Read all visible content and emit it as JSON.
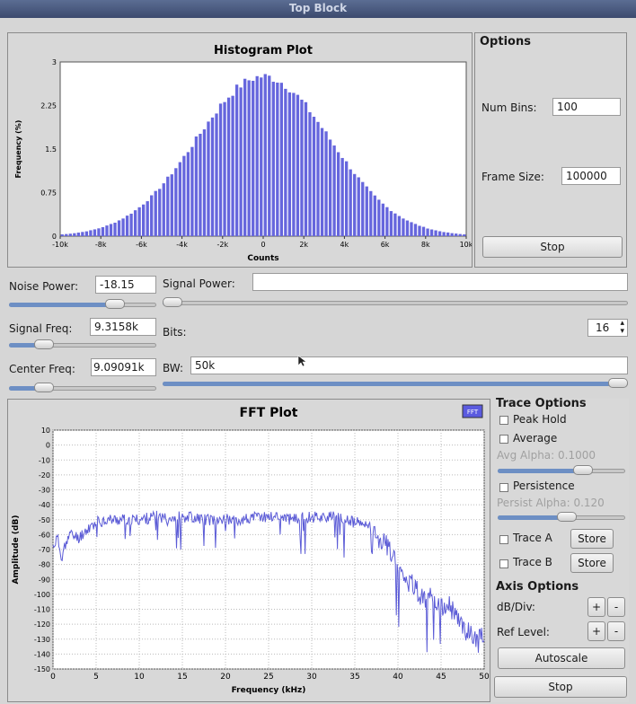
{
  "window": {
    "title": "Top Block"
  },
  "histogram": {
    "title": "Histogram Plot",
    "options_title": "Options",
    "num_bins_label": "Num Bins:",
    "num_bins_value": "100",
    "frame_size_label": "Frame Size:",
    "frame_size_value": "100000",
    "stop_label": "Stop"
  },
  "controls": {
    "noise_power_label": "Noise Power:",
    "noise_power_value": "-18.15",
    "signal_power_label": "Signal Power:",
    "signal_power_value": "",
    "signal_freq_label": "Signal Freq:",
    "signal_freq_value": "9.3158k",
    "bits_label": "Bits:",
    "bits_value": "16",
    "center_freq_label": "Center Freq:",
    "center_freq_value": "9.09091k",
    "bw_label": "BW:",
    "bw_value": "50k",
    "noise_power_level": 0.75,
    "signal_power_level": 0.0,
    "signal_freq_level": 0.2,
    "center_freq_level": 0.2,
    "bw_level": 1.0
  },
  "fft": {
    "title": "FFT Plot",
    "badge": "FFT",
    "trace_options_title": "Trace Options",
    "peak_hold_label": "Peak Hold",
    "average_label": "Average",
    "avg_alpha_label": "Avg Alpha: 0.1000",
    "avg_alpha_level": 0.7,
    "persistence_label": "Persistence",
    "persist_alpha_label": "Persist Alpha: 0.120",
    "persist_alpha_level": 0.55,
    "trace_a_label": "Trace A",
    "trace_b_label": "Trace B",
    "store_label": "Store",
    "axis_options_title": "Axis Options",
    "db_div_label": "dB/Div:",
    "ref_level_label": "Ref Level:",
    "plus_label": "+",
    "minus_label": "-",
    "autoscale_label": "Autoscale",
    "stop_label": "Stop"
  },
  "colors": {
    "trace": "#5b5bd6",
    "bar": "#6666dd",
    "slider_fill": "#6d8fc4"
  },
  "chart_data": [
    {
      "type": "bar",
      "title": "Histogram Plot",
      "xlabel": "Counts",
      "ylabel": "Frequency (%)",
      "xlim": [
        -10000,
        10000
      ],
      "ylim": [
        0,
        3
      ],
      "xticks": [
        "-10k",
        "-8k",
        "-6k",
        "-4k",
        "-2k",
        "0",
        "2k",
        "4k",
        "6k",
        "8k",
        "10k"
      ],
      "yticks": [
        "0",
        "0.75",
        "1.5",
        "2.25",
        "3"
      ],
      "distribution": "gaussian",
      "mean": 0,
      "std": 3300,
      "peak": 2.75,
      "bins": 100
    },
    {
      "type": "line",
      "title": "FFT Plot",
      "xlabel": "Frequency (kHz)",
      "ylabel": "Amplitude (dB)",
      "xlim": [
        0,
        50
      ],
      "ylim": [
        -150,
        10
      ],
      "xticks": [
        "0",
        "5",
        "10",
        "15",
        "20",
        "25",
        "30",
        "35",
        "40",
        "45",
        "50"
      ],
      "yticks": [
        "10",
        "0",
        "-10",
        "-20",
        "-30",
        "-40",
        "-50",
        "-60",
        "-70",
        "-80",
        "-90",
        "-100",
        "-110",
        "-120",
        "-130",
        "-140",
        "-150"
      ],
      "grid": true,
      "series": [
        {
          "x": [
            0,
            0.5,
            1,
            1.5,
            2,
            3,
            4,
            5,
            6,
            8,
            10,
            12,
            14,
            16,
            18,
            20,
            22,
            24,
            26,
            28,
            30,
            32,
            34,
            35,
            36,
            37,
            38,
            39,
            40,
            41,
            42,
            43,
            44,
            45,
            46,
            47,
            48,
            49,
            50
          ],
          "y": [
            -68,
            -62,
            -75,
            -64,
            -60,
            -62,
            -56,
            -52,
            -50,
            -50,
            -50,
            -48,
            -48,
            -48,
            -50,
            -50,
            -50,
            -48,
            -48,
            -50,
            -48,
            -48,
            -50,
            -52,
            -53,
            -56,
            -62,
            -70,
            -80,
            -90,
            -95,
            -105,
            -100,
            -110,
            -108,
            -118,
            -125,
            -128,
            -130
          ]
        }
      ]
    }
  ]
}
